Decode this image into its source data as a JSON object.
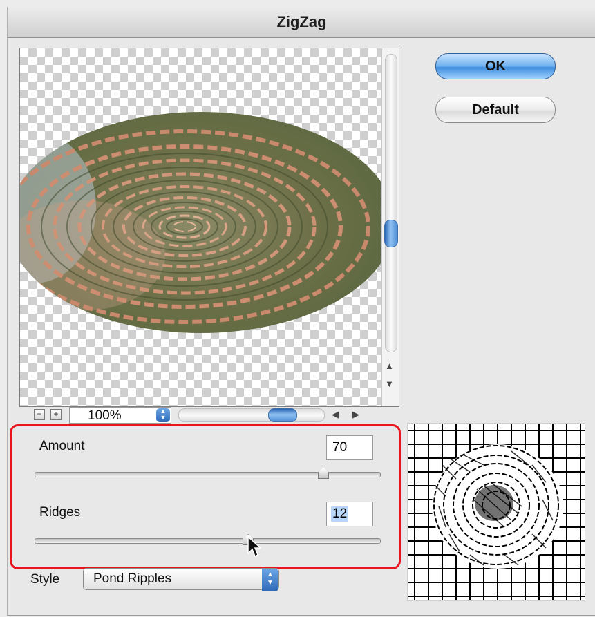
{
  "dialog": {
    "title": "ZigZag"
  },
  "buttons": {
    "ok_label": "OK",
    "default_label": "Default"
  },
  "zoom": {
    "minus_label": "−",
    "plus_label": "+",
    "value": "100%"
  },
  "parameters": {
    "amount": {
      "label": "Amount",
      "value": "70"
    },
    "ridges": {
      "label": "Ridges",
      "value": "12"
    }
  },
  "style": {
    "label": "Style",
    "selected": "Pond Ripples"
  },
  "icons": {
    "scroll_up": "up-arrow-icon",
    "scroll_down": "down-arrow-icon",
    "scroll_left": "left-arrow-icon",
    "scroll_right": "right-arrow-icon",
    "cursor": "mouse-pointer-icon"
  },
  "colors": {
    "highlight_border": "#e8141e",
    "accent_blue": "#3f8ddd"
  }
}
